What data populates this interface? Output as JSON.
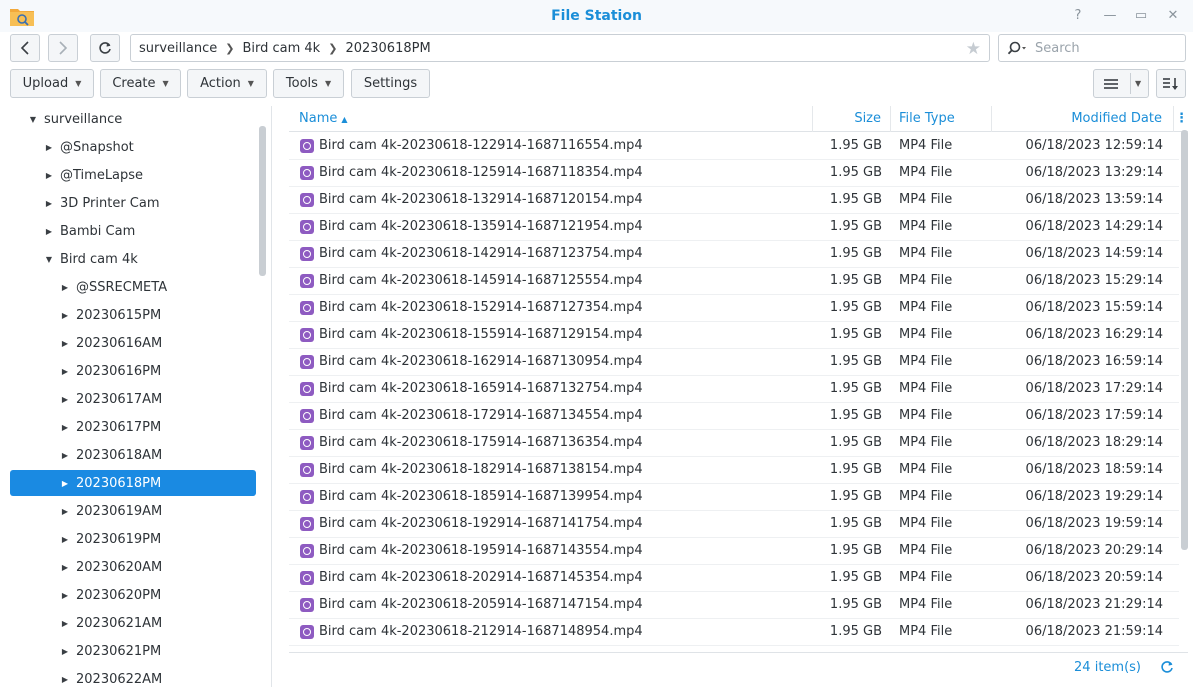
{
  "window": {
    "title": "File Station",
    "help": "?",
    "minimize": "—",
    "maximize": "▭",
    "close": "✕"
  },
  "nav": {
    "breadcrumbs": [
      "surveillance",
      "Bird cam 4k",
      "20230618PM"
    ],
    "search_placeholder": "Search"
  },
  "toolbar": {
    "upload": "Upload",
    "create": "Create",
    "action": "Action",
    "tools": "Tools",
    "settings": "Settings"
  },
  "tree": {
    "items": [
      {
        "label": "surveillance",
        "level": 0,
        "expanded": true
      },
      {
        "label": "@Snapshot",
        "level": 1,
        "expanded": false
      },
      {
        "label": "@TimeLapse",
        "level": 1,
        "expanded": false
      },
      {
        "label": "3D Printer Cam",
        "level": 1,
        "expanded": false
      },
      {
        "label": "Bambi Cam",
        "level": 1,
        "expanded": false
      },
      {
        "label": "Bird cam 4k",
        "level": 1,
        "expanded": true
      },
      {
        "label": "@SSRECMETA",
        "level": 2,
        "expanded": false
      },
      {
        "label": "20230615PM",
        "level": 2,
        "expanded": false
      },
      {
        "label": "20230616AM",
        "level": 2,
        "expanded": false
      },
      {
        "label": "20230616PM",
        "level": 2,
        "expanded": false
      },
      {
        "label": "20230617AM",
        "level": 2,
        "expanded": false
      },
      {
        "label": "20230617PM",
        "level": 2,
        "expanded": false
      },
      {
        "label": "20230618AM",
        "level": 2,
        "expanded": false
      },
      {
        "label": "20230618PM",
        "level": 2,
        "expanded": false,
        "selected": true
      },
      {
        "label": "20230619AM",
        "level": 2,
        "expanded": false
      },
      {
        "label": "20230619PM",
        "level": 2,
        "expanded": false
      },
      {
        "label": "20230620AM",
        "level": 2,
        "expanded": false
      },
      {
        "label": "20230620PM",
        "level": 2,
        "expanded": false
      },
      {
        "label": "20230621AM",
        "level": 2,
        "expanded": false
      },
      {
        "label": "20230621PM",
        "level": 2,
        "expanded": false
      },
      {
        "label": "20230622AM",
        "level": 2,
        "expanded": false
      }
    ]
  },
  "list": {
    "columns": {
      "name": "Name",
      "size": "Size",
      "type": "File Type",
      "modified": "Modified Date"
    },
    "files": [
      {
        "name": "Bird cam 4k-20230618-122914-1687116554.mp4",
        "size": "1.95 GB",
        "type": "MP4 File",
        "modified": "06/18/2023 12:59:14"
      },
      {
        "name": "Bird cam 4k-20230618-125914-1687118354.mp4",
        "size": "1.95 GB",
        "type": "MP4 File",
        "modified": "06/18/2023 13:29:14"
      },
      {
        "name": "Bird cam 4k-20230618-132914-1687120154.mp4",
        "size": "1.95 GB",
        "type": "MP4 File",
        "modified": "06/18/2023 13:59:14"
      },
      {
        "name": "Bird cam 4k-20230618-135914-1687121954.mp4",
        "size": "1.95 GB",
        "type": "MP4 File",
        "modified": "06/18/2023 14:29:14"
      },
      {
        "name": "Bird cam 4k-20230618-142914-1687123754.mp4",
        "size": "1.95 GB",
        "type": "MP4 File",
        "modified": "06/18/2023 14:59:14"
      },
      {
        "name": "Bird cam 4k-20230618-145914-1687125554.mp4",
        "size": "1.95 GB",
        "type": "MP4 File",
        "modified": "06/18/2023 15:29:14"
      },
      {
        "name": "Bird cam 4k-20230618-152914-1687127354.mp4",
        "size": "1.95 GB",
        "type": "MP4 File",
        "modified": "06/18/2023 15:59:14"
      },
      {
        "name": "Bird cam 4k-20230618-155914-1687129154.mp4",
        "size": "1.95 GB",
        "type": "MP4 File",
        "modified": "06/18/2023 16:29:14"
      },
      {
        "name": "Bird cam 4k-20230618-162914-1687130954.mp4",
        "size": "1.95 GB",
        "type": "MP4 File",
        "modified": "06/18/2023 16:59:14"
      },
      {
        "name": "Bird cam 4k-20230618-165914-1687132754.mp4",
        "size": "1.95 GB",
        "type": "MP4 File",
        "modified": "06/18/2023 17:29:14"
      },
      {
        "name": "Bird cam 4k-20230618-172914-1687134554.mp4",
        "size": "1.95 GB",
        "type": "MP4 File",
        "modified": "06/18/2023 17:59:14"
      },
      {
        "name": "Bird cam 4k-20230618-175914-1687136354.mp4",
        "size": "1.95 GB",
        "type": "MP4 File",
        "modified": "06/18/2023 18:29:14"
      },
      {
        "name": "Bird cam 4k-20230618-182914-1687138154.mp4",
        "size": "1.95 GB",
        "type": "MP4 File",
        "modified": "06/18/2023 18:59:14"
      },
      {
        "name": "Bird cam 4k-20230618-185914-1687139954.mp4",
        "size": "1.95 GB",
        "type": "MP4 File",
        "modified": "06/18/2023 19:29:14"
      },
      {
        "name": "Bird cam 4k-20230618-192914-1687141754.mp4",
        "size": "1.95 GB",
        "type": "MP4 File",
        "modified": "06/18/2023 19:59:14"
      },
      {
        "name": "Bird cam 4k-20230618-195914-1687143554.mp4",
        "size": "1.95 GB",
        "type": "MP4 File",
        "modified": "06/18/2023 20:29:14"
      },
      {
        "name": "Bird cam 4k-20230618-202914-1687145354.mp4",
        "size": "1.95 GB",
        "type": "MP4 File",
        "modified": "06/18/2023 20:59:14"
      },
      {
        "name": "Bird cam 4k-20230618-205914-1687147154.mp4",
        "size": "1.95 GB",
        "type": "MP4 File",
        "modified": "06/18/2023 21:29:14"
      },
      {
        "name": "Bird cam 4k-20230618-212914-1687148954.mp4",
        "size": "1.95 GB",
        "type": "MP4 File",
        "modified": "06/18/2023 21:59:14"
      }
    ]
  },
  "footer": {
    "item_count": "24 item(s)"
  },
  "colors": {
    "accent": "#1b8ed8",
    "selected": "#1a8ae2",
    "video_icon": "#8e5bc1"
  }
}
